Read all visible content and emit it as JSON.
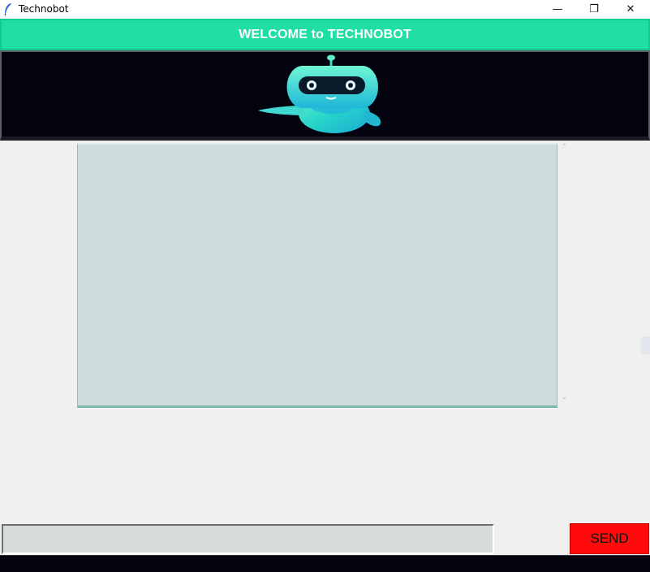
{
  "window": {
    "title": "Technobot",
    "controls": {
      "minimize": "—",
      "maximize": "❐",
      "close": "✕"
    },
    "app_icon": "feather-icon"
  },
  "banner": {
    "text": "WELCOME to TECHNOBOT",
    "color": "#1fe0a2"
  },
  "image_panel": {
    "image": "robot-mascot",
    "background": "#03030f"
  },
  "chat": {
    "transcript": "",
    "background": "#cddcdc",
    "scroll_up": "˄",
    "scroll_down": "˅"
  },
  "input": {
    "value": "",
    "placeholder": ""
  },
  "send_button": {
    "label": "SEND",
    "color": "#ff0b0b"
  }
}
